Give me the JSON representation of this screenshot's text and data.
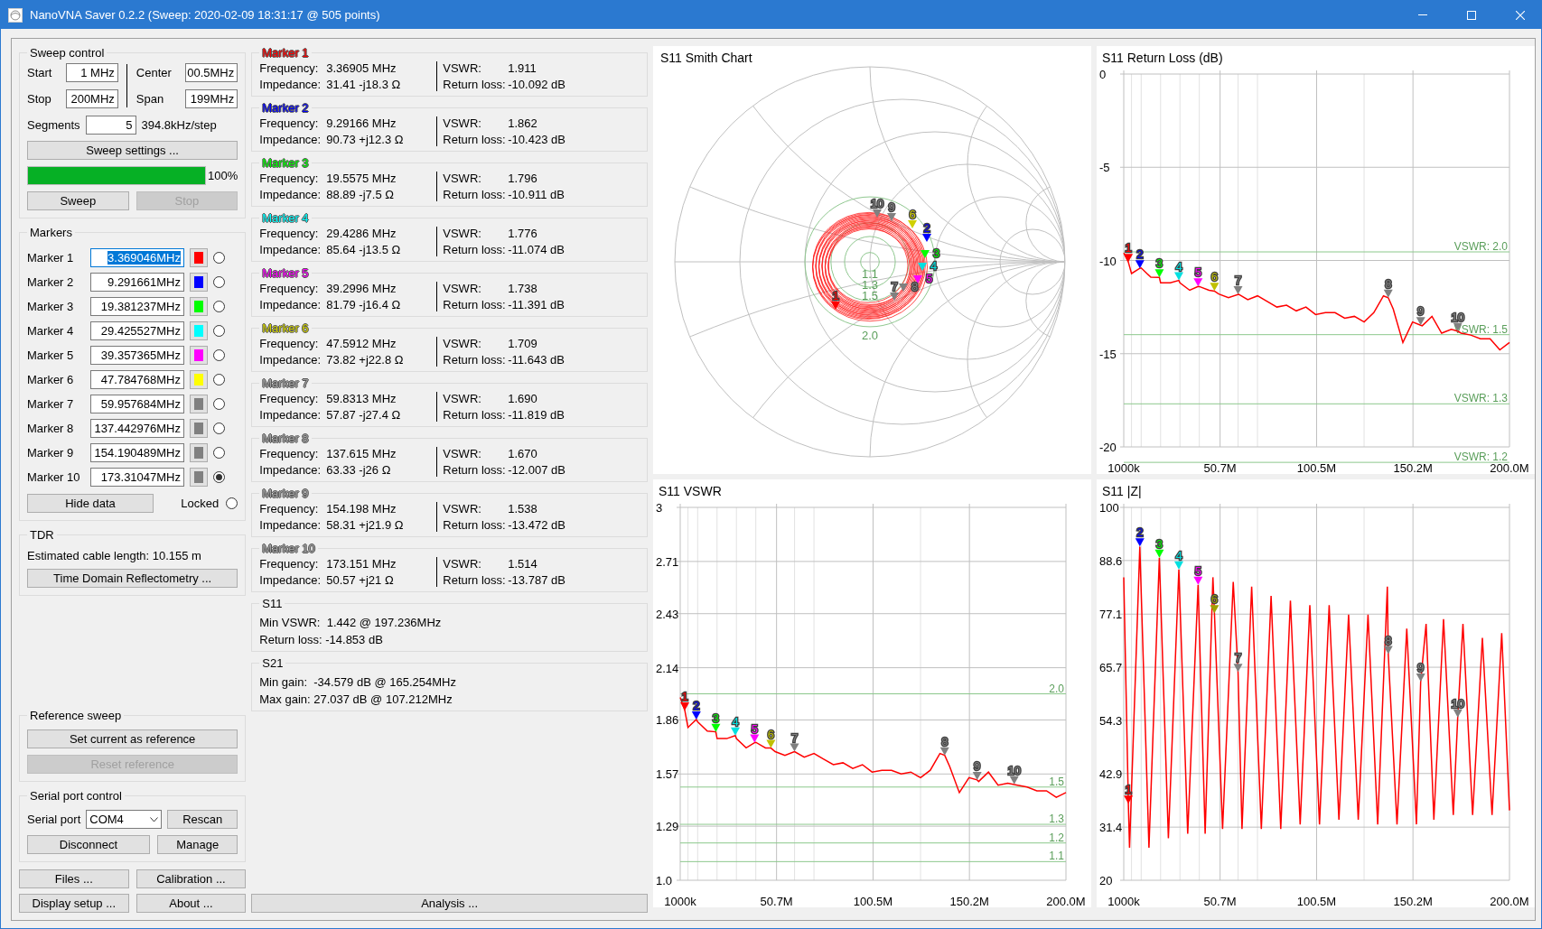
{
  "window": {
    "title": "NanoVNA Saver 0.2.2 (Sweep: 2020-02-09 18:31:17 @ 505 points)"
  },
  "sweep_control": {
    "title": "Sweep control",
    "fields": [
      {
        "label": "Start",
        "value": "1 MHz"
      },
      {
        "label": "Center",
        "value": "00.5MHz"
      },
      {
        "label": "Stop",
        "value": "200MHz"
      },
      {
        "label": "Span",
        "value": "199MHz"
      }
    ],
    "segments": {
      "label": "Segments",
      "value": "5"
    },
    "step": "394.8kHz/step",
    "settings_button": "Sweep settings ...",
    "progress": {
      "level": 1,
      "reading": "100%"
    },
    "buttons": [
      {
        "label": "Sweep",
        "disabled": false
      },
      {
        "label": "Stop",
        "disabled": true
      }
    ]
  },
  "markers": {
    "title": "Markers",
    "items": [
      {
        "label": "Marker 1",
        "frequency": "3.369046MHz",
        "text_highlighted": true,
        "color": "#ff0000",
        "selected": false
      },
      {
        "label": "Marker 2",
        "frequency": "9.291661MHz",
        "text_highlighted": false,
        "color": "#0000ff",
        "selected": false
      },
      {
        "label": "Marker 3",
        "frequency": "19.381237MHz",
        "text_highlighted": false,
        "color": "#00ff00",
        "selected": false
      },
      {
        "label": "Marker 4",
        "frequency": "29.425527MHz",
        "text_highlighted": false,
        "color": "#00ffff",
        "selected": false
      },
      {
        "label": "Marker 5",
        "frequency": "39.357365MHz",
        "text_highlighted": false,
        "color": "#ff00ff",
        "selected": false
      },
      {
        "label": "Marker 6",
        "frequency": "47.784768MHz",
        "text_highlighted": false,
        "color": "#ffff00",
        "selected": false
      },
      {
        "label": "Marker 7",
        "frequency": "59.957684MHz",
        "text_highlighted": false,
        "color": "#808080",
        "selected": false
      },
      {
        "label": "Marker 8",
        "frequency": "137.442976MHz",
        "text_highlighted": false,
        "color": "#808080",
        "selected": false
      },
      {
        "label": "Marker 9",
        "frequency": "154.190489MHz",
        "text_highlighted": false,
        "color": "#808080",
        "selected": false
      },
      {
        "label": "Marker 10",
        "frequency": "173.31047MHz",
        "text_highlighted": false,
        "color": "#808080",
        "selected": true
      }
    ],
    "hide_button": "Hide data",
    "locked": {
      "label": "Locked",
      "checked": false
    }
  },
  "tdr": {
    "title": "TDR",
    "text": "Estimated cable length: 10.155 m",
    "button": "Time Domain Reflectometry ..."
  },
  "reference_sweep": {
    "title": "Reference sweep",
    "buttons": [
      {
        "label": "Set current as reference",
        "disabled": false
      },
      {
        "label": "Reset reference",
        "disabled": true
      }
    ]
  },
  "serial_port": {
    "title": "Serial port control",
    "label": "Serial port",
    "port": "COM4",
    "rescan": "Rescan",
    "disconnect": "Disconnect",
    "manage": "Manage"
  },
  "bottom_buttons": [
    "Files ...",
    "Calibration ...",
    "Display setup ...",
    "About ..."
  ],
  "marker_data": [
    {
      "title": "Marker 1",
      "color": "#ff0000",
      "frequency": {
        "label": "Frequency:",
        "value": "3.36905 MHz"
      },
      "impedance": {
        "label": "Impedance:",
        "value": "31.41 -j18.3 Ω"
      },
      "vswr": {
        "label": "VSWR:",
        "value": "1.911"
      },
      "return_loss": {
        "label": "Return loss:",
        "value": "-10.092 dB"
      }
    },
    {
      "title": "Marker 2",
      "color": "#0000ff",
      "frequency": {
        "label": "Frequency:",
        "value": "9.29166 MHz"
      },
      "impedance": {
        "label": "Impedance:",
        "value": "90.73 +j12.3 Ω"
      },
      "vswr": {
        "label": "VSWR:",
        "value": "1.862"
      },
      "return_loss": {
        "label": "Return loss:",
        "value": "-10.423 dB"
      }
    },
    {
      "title": "Marker 3",
      "color": "#00ff00",
      "frequency": {
        "label": "Frequency:",
        "value": "19.5575 MHz"
      },
      "impedance": {
        "label": "Impedance:",
        "value": "88.89 -j7.5 Ω"
      },
      "vswr": {
        "label": "VSWR:",
        "value": "1.796"
      },
      "return_loss": {
        "label": "Return loss:",
        "value": "-10.911 dB"
      }
    },
    {
      "title": "Marker 4",
      "color": "#00ffff",
      "frequency": {
        "label": "Frequency:",
        "value": "29.4286 MHz"
      },
      "impedance": {
        "label": "Impedance:",
        "value": "85.64 -j13.5 Ω"
      },
      "vswr": {
        "label": "VSWR:",
        "value": "1.776"
      },
      "return_loss": {
        "label": "Return loss:",
        "value": "-11.074 dB"
      }
    },
    {
      "title": "Marker 5",
      "color": "#ff00ff",
      "frequency": {
        "label": "Frequency:",
        "value": "39.2996 MHz"
      },
      "impedance": {
        "label": "Impedance:",
        "value": "81.79 -j16.4 Ω"
      },
      "vswr": {
        "label": "VSWR:",
        "value": "1.738"
      },
      "return_loss": {
        "label": "Return loss:",
        "value": "-11.391 dB"
      }
    },
    {
      "title": "Marker 6",
      "color": "#d0d000",
      "frequency": {
        "label": "Frequency:",
        "value": "47.5912 MHz"
      },
      "impedance": {
        "label": "Impedance:",
        "value": "73.82 +j22.8 Ω"
      },
      "vswr": {
        "label": "VSWR:",
        "value": "1.709"
      },
      "return_loss": {
        "label": "Return loss:",
        "value": "-11.643 dB"
      }
    },
    {
      "title": "Marker 7",
      "color": "#a0a0a0",
      "frequency": {
        "label": "Frequency:",
        "value": "59.8313 MHz"
      },
      "impedance": {
        "label": "Impedance:",
        "value": "57.87 -j27.4 Ω"
      },
      "vswr": {
        "label": "VSWR:",
        "value": "1.690"
      },
      "return_loss": {
        "label": "Return loss:",
        "value": "-11.819 dB"
      }
    },
    {
      "title": "Marker 8",
      "color": "#a0a0a0",
      "frequency": {
        "label": "Frequency:",
        "value": "137.615 MHz"
      },
      "impedance": {
        "label": "Impedance:",
        "value": "63.33 -j26 Ω"
      },
      "vswr": {
        "label": "VSWR:",
        "value": "1.670"
      },
      "return_loss": {
        "label": "Return loss:",
        "value": "-12.007 dB"
      }
    },
    {
      "title": "Marker 9",
      "color": "#a0a0a0",
      "frequency": {
        "label": "Frequency:",
        "value": "154.198 MHz"
      },
      "impedance": {
        "label": "Impedance:",
        "value": "58.31 +j21.9 Ω"
      },
      "vswr": {
        "label": "VSWR:",
        "value": "1.538"
      },
      "return_loss": {
        "label": "Return loss:",
        "value": "-13.472 dB"
      }
    },
    {
      "title": "Marker 10",
      "color": "#a0a0a0",
      "frequency": {
        "label": "Frequency:",
        "value": "173.151 MHz"
      },
      "impedance": {
        "label": "Impedance:",
        "value": "50.57 +j21 Ω"
      },
      "vswr": {
        "label": "VSWR:",
        "value": "1.514"
      },
      "return_loss": {
        "label": "Return loss:",
        "value": "-13.787 dB"
      }
    }
  ],
  "s11_summary": {
    "title": "S11",
    "lines": [
      "Min VSWR:  1.442 @ 197.236MHz",
      "Return loss: -14.853 dB"
    ]
  },
  "s21_summary": {
    "title": "S21",
    "lines": [
      "Min gain:  -34.579 dB @ 165.254MHz",
      "Max gain: 27.037 dB @ 107.212MHz"
    ]
  },
  "analysis_button": "Analysis ...",
  "charts": [
    {
      "kind": "smith",
      "title": "S11 Smith Chart",
      "vswr_circles": [
        "1.1",
        "1.3",
        "1.5",
        "2.0"
      ],
      "markers": [
        {
          "label": "1",
          "color": "#ff0000"
        },
        {
          "label": "2",
          "color": "#0000ff"
        },
        {
          "label": "3",
          "color": "#00ff00"
        },
        {
          "label": "4",
          "color": "#00e0e0"
        },
        {
          "label": "5",
          "color": "#ff00ff"
        },
        {
          "label": "6",
          "color": "#d0d000"
        },
        {
          "label": "7",
          "color": "#808080"
        },
        {
          "label": "8",
          "color": "#808080"
        },
        {
          "label": "9",
          "color": "#808080"
        },
        {
          "label": "10",
          "color": "#808080"
        }
      ]
    },
    {
      "kind": "line",
      "guides": [
        {
          "label": "VSWR: 2.0"
        },
        {
          "label": "VSWR: 1.5"
        },
        {
          "label": "VSWR: 1.3"
        },
        {
          "label": "VSWR: 1.2"
        }
      ],
      "markers": [
        {
          "color": "#ff0000"
        },
        {
          "color": "#0000ff"
        },
        {
          "color": "#00ff00"
        },
        {
          "color": "#00e0e0"
        },
        {
          "color": "#ff00ff"
        },
        {
          "color": "#c0c000"
        },
        {
          "color": "#808080"
        },
        {
          "color": "#808080"
        },
        {
          "color": "#808080"
        },
        {
          "color": "#808080"
        }
      ],
      "chart_data": {
        "type": "line",
        "title": "S11 Return Loss (dB)",
        "grid": true,
        "xlim": [
          1000000,
          200000000
        ],
        "ylim": [
          -20,
          0
        ],
        "yticks": [
          0,
          -5,
          -10,
          -15,
          -20
        ],
        "xticks": [
          {
            "value": 1000000,
            "label": "1000k"
          },
          {
            "value": 50700000,
            "label": "50.7M"
          },
          {
            "value": 100500000,
            "label": "100.5M"
          },
          {
            "value": 150200000,
            "label": "150.2M"
          },
          {
            "value": 200000000,
            "label": "200.0M"
          }
        ],
        "x": [
          1000000,
          3369046,
          5000000,
          9291661,
          10000000,
          15000000,
          19381237,
          20000000,
          25000000,
          29425527,
          30000000,
          35000000,
          39357365,
          40000000,
          45000000,
          47784768,
          50000000,
          55000000,
          59957684,
          60000000,
          65000000,
          70000000,
          75000000,
          80000000,
          85000000,
          90000000,
          95000000,
          100000000,
          105000000,
          110000000,
          115000000,
          120000000,
          125000000,
          130000000,
          135000000,
          137442976,
          140000000,
          145000000,
          150000000,
          154190489,
          155000000,
          160000000,
          165000000,
          170000000,
          173310470,
          175000000,
          180000000,
          185000000,
          190000000,
          195000000,
          200000000
        ],
        "ref_lines": [
          {
            "axis": "y",
            "value": -9.54
          },
          {
            "axis": "y",
            "value": -13.98
          },
          {
            "axis": "y",
            "value": -17.69
          },
          {
            "axis": "y",
            "value": -20.83
          }
        ],
        "series": [
          {
            "color": "#ff0000",
            "values": [
              -9.6,
              -10.09,
              -10.7,
              -10.42,
              -10.4,
              -10.9,
              -10.91,
              -11.2,
              -11.2,
              -11.07,
              -11.2,
              -11.6,
              -11.39,
              -11.4,
              -11.6,
              -11.64,
              -11.8,
              -12.0,
              -11.82,
              -11.8,
              -12.1,
              -11.9,
              -12.2,
              -12.5,
              -12.4,
              -12.7,
              -12.5,
              -12.9,
              -12.8,
              -12.8,
              -13.1,
              -13.0,
              -13.3,
              -12.8,
              -11.9,
              -12.0,
              -12.6,
              -14.4,
              -13.3,
              -13.47,
              -13.5,
              -13.0,
              -13.9,
              -13.7,
              -13.79,
              -13.9,
              -14.0,
              -14.2,
              -14.2,
              -14.8,
              -14.4
            ]
          }
        ],
        "annotations": [
          {
            "x": 3369046,
            "y": -10.09,
            "text": "1"
          },
          {
            "x": 9291661,
            "y": -10.42,
            "text": "2"
          },
          {
            "x": 19381237,
            "y": -10.91,
            "text": "3"
          },
          {
            "x": 29425527,
            "y": -11.07,
            "text": "4"
          },
          {
            "x": 39357365,
            "y": -11.39,
            "text": "5"
          },
          {
            "x": 47784768,
            "y": -11.64,
            "text": "6"
          },
          {
            "x": 59957684,
            "y": -11.82,
            "text": "7"
          },
          {
            "x": 137442976,
            "y": -12.0,
            "text": "8"
          },
          {
            "x": 154190489,
            "y": -13.47,
            "text": "9"
          },
          {
            "x": 173310470,
            "y": -13.79,
            "text": "10"
          }
        ]
      }
    },
    {
      "kind": "line",
      "markers": [
        {
          "color": "#ff0000"
        },
        {
          "color": "#0000ff"
        },
        {
          "color": "#00ff00"
        },
        {
          "color": "#00e0e0"
        },
        {
          "color": "#ff00ff"
        },
        {
          "color": "#c0c000"
        },
        {
          "color": "#808080"
        },
        {
          "color": "#808080"
        },
        {
          "color": "#808080"
        },
        {
          "color": "#808080"
        }
      ],
      "chart_data": {
        "type": "line",
        "title": "S11 VSWR",
        "grid": true,
        "xlim": [
          1000000,
          200000000
        ],
        "ylim": [
          1,
          3
        ],
        "yticks": [
          {
            "value": 3,
            "label": "3"
          },
          {
            "value": 2.71,
            "label": "2.71"
          },
          {
            "value": 2.43,
            "label": "2.43"
          },
          {
            "value": 2.14,
            "label": "2.14"
          },
          {
            "value": 1.86,
            "label": "1.86"
          },
          {
            "value": 1.57,
            "label": "1.57"
          },
          {
            "value": 1.29,
            "label": "1.29"
          },
          {
            "value": 1,
            "label": "1.0"
          }
        ],
        "xticks": [
          {
            "value": 1000000,
            "label": "1000k"
          },
          {
            "value": 50700000,
            "label": "50.7M"
          },
          {
            "value": 100500000,
            "label": "100.5M"
          },
          {
            "value": 150200000,
            "label": "150.2M"
          },
          {
            "value": 200000000,
            "label": "200.0M"
          }
        ],
        "x": [
          1000000,
          3369046,
          5000000,
          9291661,
          10000000,
          15000000,
          19381237,
          20000000,
          25000000,
          29425527,
          30000000,
          35000000,
          39357365,
          40000000,
          45000000,
          47784768,
          50000000,
          55000000,
          59957684,
          60000000,
          65000000,
          70000000,
          75000000,
          80000000,
          85000000,
          90000000,
          95000000,
          100000000,
          105000000,
          110000000,
          115000000,
          120000000,
          125000000,
          130000000,
          135000000,
          137442976,
          140000000,
          145000000,
          150000000,
          154190489,
          155000000,
          160000000,
          165000000,
          170000000,
          173310470,
          175000000,
          180000000,
          185000000,
          190000000,
          195000000,
          200000000
        ],
        "ref_lines": [
          {
            "axis": "y",
            "value": 2.0,
            "label": "2.0"
          },
          {
            "axis": "y",
            "value": 1.5,
            "label": "1.5"
          },
          {
            "axis": "y",
            "value": 1.3,
            "label": "1.3"
          },
          {
            "axis": "y",
            "value": 1.2,
            "label": "1.2"
          },
          {
            "axis": "y",
            "value": 1.1,
            "label": "1.1"
          }
        ],
        "series": [
          {
            "color": "#ff0000",
            "values": [
              1.98,
              1.911,
              1.82,
              1.862,
              1.85,
              1.8,
              1.796,
              1.76,
              1.76,
              1.776,
              1.76,
              1.71,
              1.738,
              1.74,
              1.71,
              1.709,
              1.69,
              1.67,
              1.69,
              1.69,
              1.66,
              1.68,
              1.65,
              1.62,
              1.63,
              1.6,
              1.62,
              1.58,
              1.59,
              1.59,
              1.57,
              1.58,
              1.55,
              1.59,
              1.68,
              1.67,
              1.61,
              1.47,
              1.55,
              1.538,
              1.53,
              1.58,
              1.51,
              1.52,
              1.514,
              1.51,
              1.5,
              1.48,
              1.48,
              1.445,
              1.47
            ]
          }
        ],
        "annotations": [
          {
            "x": 3369046,
            "y": 1.911,
            "text": "1"
          },
          {
            "x": 9291661,
            "y": 1.862,
            "text": "2"
          },
          {
            "x": 19381237,
            "y": 1.796,
            "text": "3"
          },
          {
            "x": 29425527,
            "y": 1.776,
            "text": "4"
          },
          {
            "x": 39357365,
            "y": 1.738,
            "text": "5"
          },
          {
            "x": 47784768,
            "y": 1.709,
            "text": "6"
          },
          {
            "x": 59957684,
            "y": 1.69,
            "text": "7"
          },
          {
            "x": 137442976,
            "y": 1.67,
            "text": "8"
          },
          {
            "x": 154190489,
            "y": 1.538,
            "text": "9"
          },
          {
            "x": 173310470,
            "y": 1.514,
            "text": "10"
          }
        ]
      }
    },
    {
      "kind": "line",
      "markers": [
        {
          "color": "#ff0000"
        },
        {
          "color": "#0000ff"
        },
        {
          "color": "#00ff00"
        },
        {
          "color": "#00e0e0"
        },
        {
          "color": "#ff00ff"
        },
        {
          "color": "#a0a000"
        },
        {
          "color": "#808080"
        },
        {
          "color": "#808080"
        },
        {
          "color": "#808080"
        },
        {
          "color": "#808080"
        }
      ],
      "chart_data": {
        "type": "line",
        "title": "S11 |Z|",
        "grid": true,
        "xlim": [
          1000000,
          200000000
        ],
        "ylim": [
          20,
          100
        ],
        "yticks": [
          100,
          88.6,
          77.1,
          65.7,
          54.3,
          42.9,
          31.4,
          20
        ],
        "xticks": [
          {
            "value": 1000000,
            "label": "1000k"
          },
          {
            "value": 50700000,
            "label": "50.7M"
          },
          {
            "value": 100500000,
            "label": "100.5M"
          },
          {
            "value": 150200000,
            "label": "150.2M"
          },
          {
            "value": 200000000,
            "label": "200.0M"
          }
        ],
        "x": [
          1000000,
          3369046,
          4000000,
          9291661,
          14000000,
          19381237,
          24000000,
          29425527,
          34000000,
          39357365,
          43000000,
          47000000,
          47784768,
          52000000,
          57500000,
          59957684,
          62000000,
          67000000,
          72000000,
          77000000,
          82000000,
          87000000,
          92000000,
          97000000,
          102000000,
          107000000,
          112000000,
          117000000,
          122000000,
          127000000,
          132000000,
          137000000,
          137442976,
          142000000,
          147000000,
          152000000,
          154190489,
          157000000,
          161000000,
          166000000,
          171000000,
          173310470,
          176000000,
          181000000,
          186000000,
          191000000,
          196000000,
          200000000
        ],
        "series": [
          {
            "color": "#ff0000",
            "values": [
              85,
              36.4,
              27,
              91.6,
              27,
              89.2,
              29,
              86.7,
              30,
              83.4,
              30,
              85,
              77.3,
              31,
              84,
              64.7,
              31,
              83,
              31,
              81,
              31,
              80,
              32,
              79,
              32,
              79,
              33,
              77,
              33,
              77,
              32,
              83,
              68.5,
              32,
              74,
              32,
              62.6,
              75,
              33,
              76,
              34,
              54.9,
              75,
              34,
              72,
              34,
              73,
              35
            ]
          }
        ],
        "annotations": [
          {
            "x": 3369046,
            "y": 36.4,
            "text": "1"
          },
          {
            "x": 9291661,
            "y": 91.6,
            "text": "2"
          },
          {
            "x": 19381237,
            "y": 89.2,
            "text": "3"
          },
          {
            "x": 29425527,
            "y": 86.7,
            "text": "4"
          },
          {
            "x": 39357365,
            "y": 83.4,
            "text": "5"
          },
          {
            "x": 47784768,
            "y": 77.3,
            "text": "6"
          },
          {
            "x": 59957684,
            "y": 64.7,
            "text": "7"
          },
          {
            "x": 137442976,
            "y": 68.5,
            "text": "8"
          },
          {
            "x": 154190489,
            "y": 62.6,
            "text": "9"
          },
          {
            "x": 173310470,
            "y": 54.9,
            "text": "10"
          }
        ]
      }
    }
  ]
}
